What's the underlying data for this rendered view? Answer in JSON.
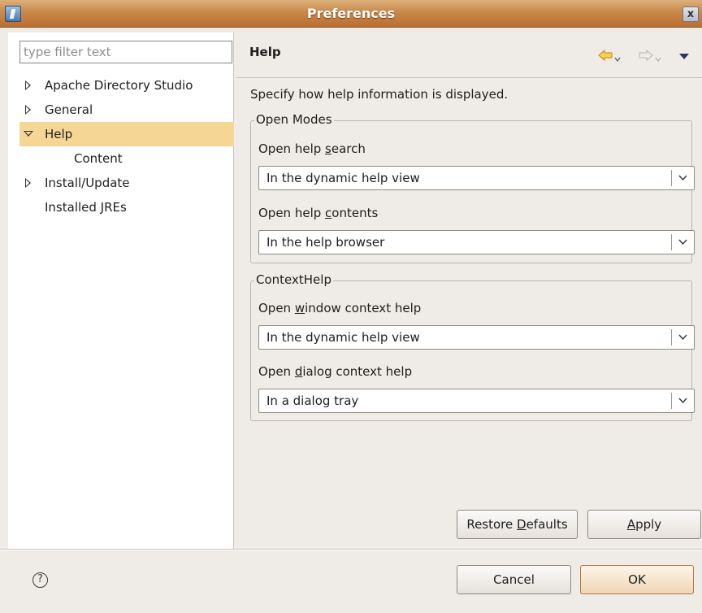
{
  "window": {
    "title": "Preferences",
    "close_label": "x"
  },
  "sidebar": {
    "filter_placeholder": "type filter text",
    "filter_value": "",
    "items": [
      {
        "label": "Apache Directory Studio",
        "state": "collapsed"
      },
      {
        "label": "General",
        "state": "collapsed"
      },
      {
        "label": "Help",
        "state": "expanded",
        "selected": true
      },
      {
        "label": "Content",
        "state": "child"
      },
      {
        "label": "Install/Update",
        "state": "collapsed"
      },
      {
        "label": "Installed JREs",
        "state": "leaf"
      }
    ],
    "scrollbar_grip": "III"
  },
  "page": {
    "title": "Help",
    "description": "Specify how help information is displayed.",
    "groups": [
      {
        "legend": "Open Modes",
        "fields": [
          {
            "label_pre": "Open help ",
            "label_mnemonic": "s",
            "label_post": "earch",
            "value": "In the dynamic help view"
          },
          {
            "label_pre": "Open help ",
            "label_mnemonic": "c",
            "label_post": "ontents",
            "value": "In the help browser"
          }
        ]
      },
      {
        "legend": "ContextHelp",
        "fields": [
          {
            "label_pre": "Open ",
            "label_mnemonic": "w",
            "label_post": "indow context help",
            "value": "In the dynamic help view"
          },
          {
            "label_pre": "Open ",
            "label_mnemonic": "d",
            "label_post": "ialog context help",
            "value": "In a dialog tray"
          }
        ]
      }
    ],
    "restore_defaults": {
      "pre": "Restore ",
      "mnemonic": "D",
      "post": "efaults"
    },
    "apply": {
      "pre": "",
      "mnemonic": "A",
      "post": "pply"
    }
  },
  "footer": {
    "help_icon": "?",
    "cancel_label": "Cancel",
    "ok_label": "OK"
  },
  "colors": {
    "title_bar": "#c8884a",
    "selection": "#f6d695",
    "window_bg": "#efebe7",
    "nav_arrow": "#e2a81f"
  }
}
